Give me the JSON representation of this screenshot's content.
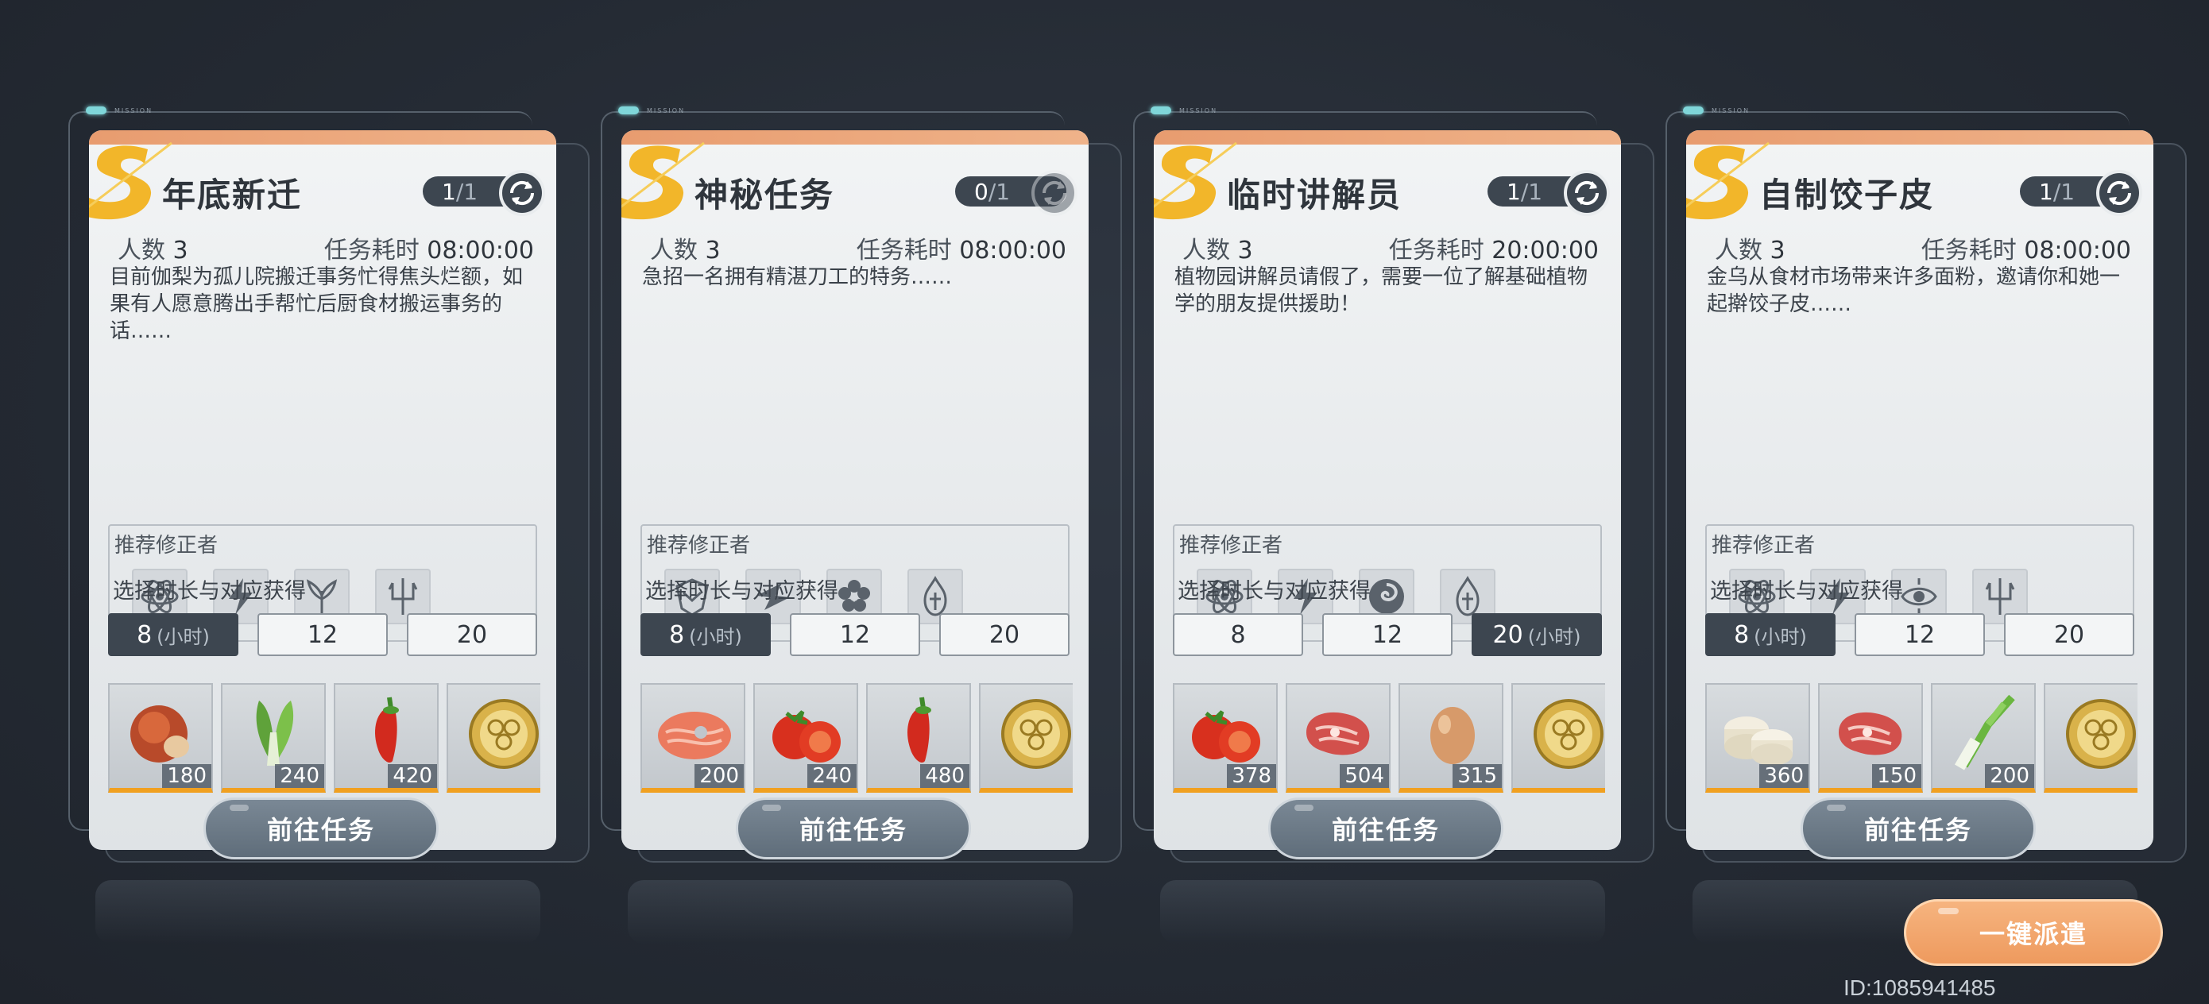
{
  "cards": [
    {
      "mission_tag": "MISSION",
      "title": "年底新迁",
      "slot_current": "1",
      "slot_total": "/1",
      "people_label": "人数",
      "people": "3",
      "time_label": "任务耗时",
      "time": "08:00:00",
      "desc": "目前伽梨为孤儿院搬迁事务忙得焦头烂额，如果有人愿意腾出手帮忙后厨食材搬运事务的话……",
      "rec_label": "推荐修正者",
      "rec_icons": [
        "atom-icon",
        "lightning-icon",
        "plant-icon",
        "trident-icon"
      ],
      "dur_label": "选择时长与对应获得",
      "durations": [
        "8",
        "12",
        "20"
      ],
      "selected_duration": 0,
      "unit": "(小时)",
      "rewards": [
        {
          "icon": "chestnut-icon",
          "count": "180"
        },
        {
          "icon": "bok-choy-icon",
          "count": "240"
        },
        {
          "icon": "chili-icon",
          "count": "420"
        },
        {
          "icon": "coin-icon",
          "count": ""
        }
      ],
      "go_label": "前往任务"
    },
    {
      "mission_tag": "MISSION",
      "title": "神秘任务",
      "slot_current": "0",
      "slot_total": "/1",
      "people_label": "人数",
      "people": "3",
      "time_label": "任务耗时",
      "time": "08:00:00",
      "desc": "急招一名拥有精湛刀工的特务……",
      "rec_label": "推荐修正者",
      "rec_icons": [
        "shield-icon",
        "blade-icon",
        "flower-icon",
        "flame-icon"
      ],
      "dur_label": "选择时长与对应获得",
      "durations": [
        "8",
        "12",
        "20"
      ],
      "selected_duration": 0,
      "unit": "(小时)",
      "rewards": [
        {
          "icon": "salmon-icon",
          "count": "200"
        },
        {
          "icon": "tomato-icon",
          "count": "240"
        },
        {
          "icon": "chili-icon",
          "count": "480"
        },
        {
          "icon": "coin-icon",
          "count": ""
        }
      ],
      "go_label": "前往任务"
    },
    {
      "mission_tag": "MISSION",
      "title": "临时讲解员",
      "slot_current": "1",
      "slot_total": "/1",
      "people_label": "人数",
      "people": "3",
      "time_label": "任务耗时",
      "time": "20:00:00",
      "desc": "植物园讲解员请假了，需要一位了解基础植物学的朋友提供援助！",
      "rec_label": "推荐修正者",
      "rec_icons": [
        "atom-icon",
        "lightning-icon",
        "swirl-icon",
        "flame-icon"
      ],
      "dur_label": "选择时长与对应获得",
      "durations": [
        "8",
        "12",
        "20"
      ],
      "selected_duration": 2,
      "unit": "(小时)",
      "rewards": [
        {
          "icon": "tomato-icon",
          "count": "378"
        },
        {
          "icon": "steak-icon",
          "count": "504"
        },
        {
          "icon": "egg-icon",
          "count": "315"
        },
        {
          "icon": "coin-icon",
          "count": ""
        }
      ],
      "go_label": "前往任务"
    },
    {
      "mission_tag": "MISSION",
      "title": "自制饺子皮",
      "slot_current": "1",
      "slot_total": "/1",
      "people_label": "人数",
      "people": "3",
      "time_label": "任务耗时",
      "time": "08:00:00",
      "desc": "金乌从食材市场带来许多面粉，邀请你和她一起擀饺子皮……",
      "rec_label": "推荐修正者",
      "rec_icons": [
        "atom-icon",
        "lightning-icon",
        "eye-icon",
        "trident-icon"
      ],
      "dur_label": "选择时长与对应获得",
      "durations": [
        "8",
        "12",
        "20"
      ],
      "selected_duration": 0,
      "unit": "(小时)",
      "rewards": [
        {
          "icon": "rice-cake-icon",
          "count": "360"
        },
        {
          "icon": "steak-icon",
          "count": "150"
        },
        {
          "icon": "scallion-icon",
          "count": "200"
        },
        {
          "icon": "coin-icon",
          "count": ""
        }
      ],
      "go_label": "前往任务"
    }
  ],
  "dispatch_label": "一键派遣",
  "user_id": "ID:1085941485",
  "colors": {
    "accent_orange": "#ee9a5e",
    "dark_slate": "#3d4650",
    "bar_gold": "#f0a020"
  }
}
